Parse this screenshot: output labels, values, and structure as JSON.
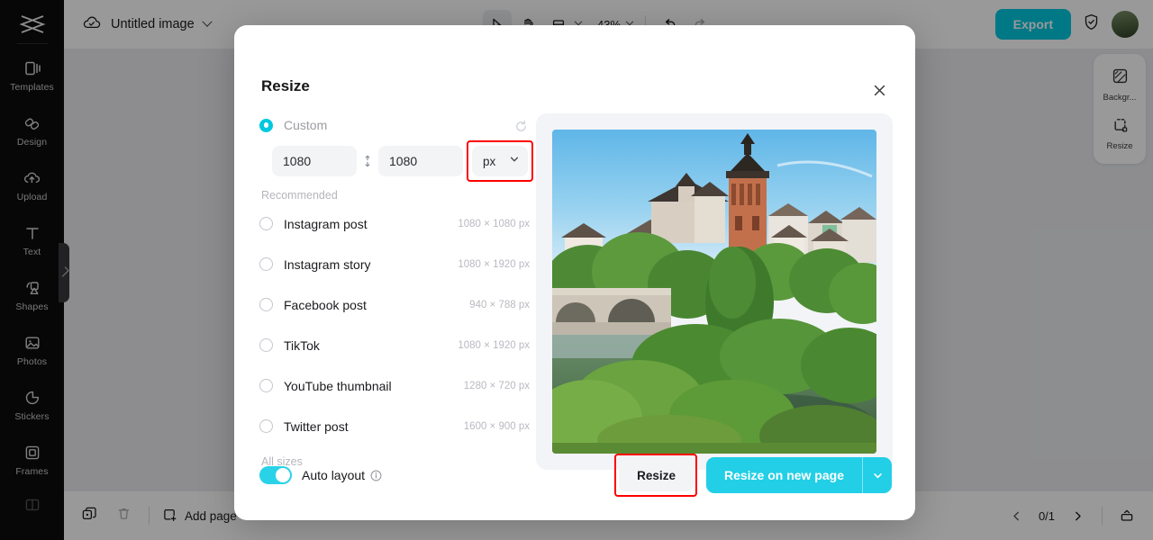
{
  "app": {
    "document_title": "Untitled image",
    "zoom_level": "43%",
    "export_label": "Export",
    "accent_color": "#22cfe6",
    "highlight_color": "#ff0000"
  },
  "sidebar": {
    "logo_name": "capcut-logo",
    "items": [
      {
        "label": "Templates",
        "icon": "templates-icon"
      },
      {
        "label": "Design",
        "icon": "design-icon"
      },
      {
        "label": "Upload",
        "icon": "upload-cloud-icon"
      },
      {
        "label": "Text",
        "icon": "text-icon"
      },
      {
        "label": "Shapes",
        "icon": "shapes-icon"
      },
      {
        "label": "Photos",
        "icon": "photos-icon"
      },
      {
        "label": "Stickers",
        "icon": "stickers-icon"
      },
      {
        "label": "Frames",
        "icon": "frames-icon"
      }
    ]
  },
  "toolbar": {
    "cloud_status_icon": "cloud-check-icon",
    "title_dropdown_icon": "chevron-down-icon",
    "select_tool_icon": "cursor-arrow-icon",
    "hand_tool_icon": "hand-icon",
    "crop_tool_icon": "crop-icon",
    "undo_icon": "undo-arrow-icon",
    "redo_icon": "redo-arrow-icon",
    "shield_icon": "shield-check-icon",
    "avatar_name": "user-avatar"
  },
  "right_panel": {
    "items": [
      {
        "label": "Backgr...",
        "icon": "background-icon"
      },
      {
        "label": "Resize",
        "icon": "resize-icon"
      }
    ]
  },
  "bottom_bar": {
    "duplicate_icon": "duplicate-page-icon",
    "delete_icon": "trash-icon",
    "add_page_label": "Add page",
    "add_page_icon": "plus-square-icon",
    "prev_icon": "chevron-left-icon",
    "next_icon": "chevron-right-icon",
    "page_count": "0/1",
    "panel_toggle_icon": "panel-toggle-icon"
  },
  "modal": {
    "title": "Resize",
    "close_icon": "close-icon",
    "custom": {
      "label": "Custom",
      "selected": true,
      "width_value": "1080",
      "height_value": "1080",
      "link_icon": "link-dimensions-icon",
      "unit": "px",
      "unit_caret_icon": "chevron-down-icon",
      "reset_icon": "reset-circle-icon",
      "highlighted": true
    },
    "recommended_label": "Recommended",
    "presets": [
      {
        "label": "Instagram post",
        "size": "1080 × 1080 px"
      },
      {
        "label": "Instagram story",
        "size": "1080 × 1920 px"
      },
      {
        "label": "Facebook post",
        "size": "940 × 788 px"
      },
      {
        "label": "TikTok",
        "size": "1080 × 1920 px"
      },
      {
        "label": "YouTube thumbnail",
        "size": "1280 × 720 px"
      },
      {
        "label": "Twitter post",
        "size": "1600 × 900 px"
      }
    ],
    "all_sizes_label": "All sizes",
    "preview_alt": "Town with church tower, stone arch bridge and green riverbank",
    "footer": {
      "auto_layout_label": "Auto layout",
      "auto_layout_on": true,
      "info_icon": "info-icon",
      "resize_label": "Resize",
      "resize_highlighted": true,
      "resize_new_page_label": "Resize on new page",
      "resize_new_page_caret_icon": "chevron-down-icon"
    }
  }
}
